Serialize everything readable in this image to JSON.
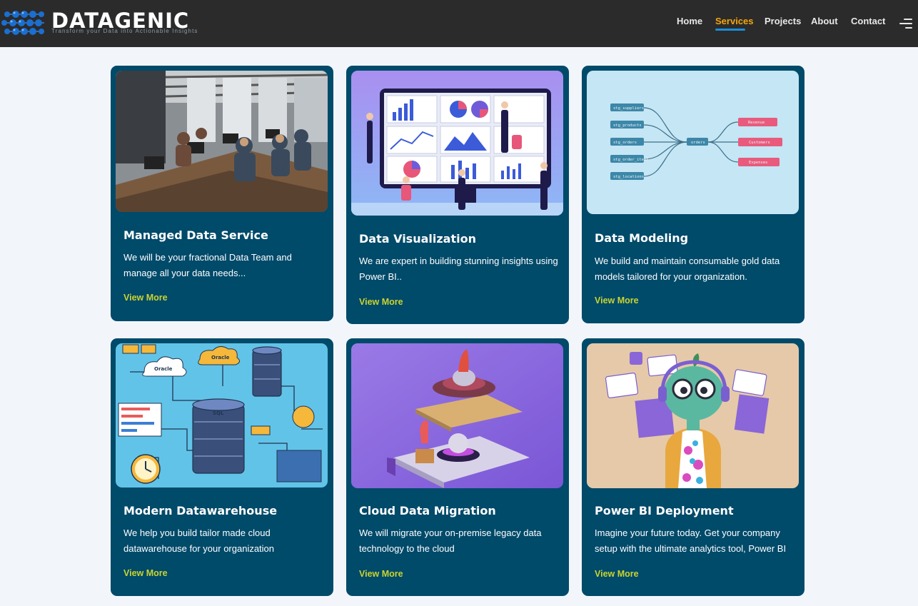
{
  "header": {
    "brand": "DATAGENIC",
    "tagline": "Transform your Data into Actionable Insights",
    "nav": [
      {
        "label": "Home",
        "active": false
      },
      {
        "label": "Services",
        "active": true
      },
      {
        "label": "Projects",
        "active": false
      },
      {
        "label": "About",
        "active": false
      },
      {
        "label": "Contact",
        "active": false
      }
    ],
    "colors": {
      "background": "#2b2b2b",
      "active": "#f4a60c",
      "underline": "#1a8fd8"
    }
  },
  "services": [
    {
      "title": "Managed Data Service",
      "description": "We will be your fractional Data Team and manage all your data needs...",
      "link": "View More",
      "image": "office-team-photo"
    },
    {
      "title": "Data Visualization",
      "description": "We are expert in building stunning insights using Power BI..",
      "link": "View More",
      "image": "dashboard-illustration"
    },
    {
      "title": "Data Modeling",
      "description": "We build and maintain consumable gold data models tailored for your organization.",
      "link": "View More",
      "image": "lineage-diagram",
      "diagram": {
        "sources": [
          "stg_suppliers",
          "stg_products",
          "stg_orders",
          "stg_order_items",
          "stg_locations"
        ],
        "hub": "orders",
        "outputs": [
          "Revenue",
          "Customers",
          "Expenses"
        ]
      }
    },
    {
      "title": "Modern Datawarehouse",
      "description": "We help you build tailor made cloud datawarehouse for your organization",
      "link": "View More",
      "image": "warehouse-illustration",
      "labels": [
        "Oracle",
        "Oracle",
        "SQL"
      ]
    },
    {
      "title": "Cloud Data Migration",
      "description": "We will migrate your on-premise legacy data technology to the cloud",
      "link": "View More",
      "image": "migration-illustration"
    },
    {
      "title": "Power BI Deployment",
      "description": "Imagine your future today. Get your company setup with the ultimate analytics tool, Power BI",
      "link": "View More",
      "image": "robot-illustration"
    }
  ],
  "colors": {
    "card": "#004a6a",
    "link": "#c9d42f",
    "page": "#f2f6fb"
  }
}
